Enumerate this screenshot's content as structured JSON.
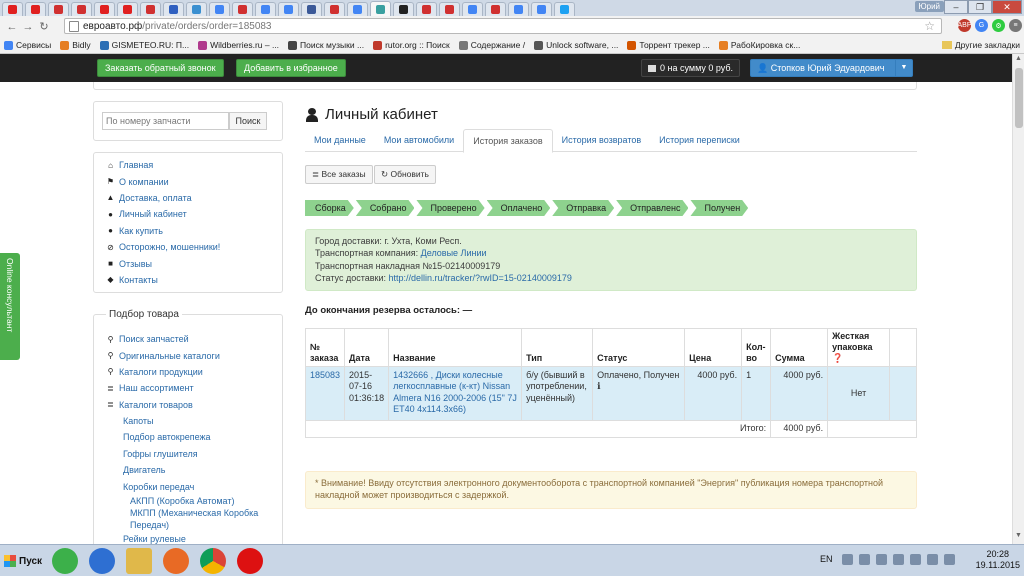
{
  "browser": {
    "tabs": [
      {
        "icon": "youtube",
        "color": "#e02020"
      },
      {
        "icon": "youtube",
        "color": "#e02020"
      },
      {
        "icon": "D",
        "color": "#d03030"
      },
      {
        "icon": "D",
        "color": "#d03030"
      },
      {
        "icon": "youtube",
        "color": "#e02020"
      },
      {
        "icon": "youtube",
        "color": "#e02020"
      },
      {
        "icon": "D",
        "color": "#d03030"
      },
      {
        "icon": "translate",
        "color": "#3060c0"
      },
      {
        "icon": "Jr",
        "color": "#3a8fd0"
      },
      {
        "icon": "G",
        "color": "#4285f4"
      },
      {
        "icon": "N",
        "color": "#d03030"
      },
      {
        "icon": "G",
        "color": "#4285f4"
      },
      {
        "icon": "G",
        "color": "#4285f4"
      },
      {
        "icon": "facebook",
        "color": "#3b5998"
      },
      {
        "icon": "D",
        "color": "#d03030"
      },
      {
        "icon": "G",
        "color": "#4285f4"
      },
      {
        "icon": "ea",
        "color": "#3aa0a0"
      },
      {
        "icon": "amazon",
        "color": "#222"
      },
      {
        "icon": "gift",
        "color": "#d03030"
      },
      {
        "icon": "gift",
        "color": "#d03030"
      },
      {
        "icon": "G",
        "color": "#4285f4"
      },
      {
        "icon": "gift",
        "color": "#d03030"
      },
      {
        "icon": "G",
        "color": "#4285f4"
      },
      {
        "icon": "G",
        "color": "#4285f4"
      },
      {
        "icon": "twitter",
        "color": "#1da1f2"
      }
    ],
    "user_badge": "Юрий",
    "url_host": "евроавто.рф",
    "url_path": "/private/orders/order=185083",
    "bookmarks": [
      "Сервисы",
      "Bidly",
      "GISMETEO.RU: П...",
      "Wildberries.ru – ...",
      "Поиск музыки ...",
      "rutor.org :: Поиск",
      "Содержание /",
      "Unlock software, ...",
      "Торрент трекер ...",
      "РабоКировка ск..."
    ],
    "other_bookmarks": "Другие закладки"
  },
  "site": {
    "callback_btn": "Заказать обратный звонок",
    "favorites_btn": "Добавить в избранное",
    "cart": "0 на сумму 0 руб.",
    "user": "Стопков Юрий Эдуардович"
  },
  "sidebar": {
    "search_placeholder": "По номеру запчасти",
    "search_btn": "Поиск",
    "menu": [
      {
        "label": "Главная",
        "icon": "home-icon",
        "glyph": "⌂"
      },
      {
        "label": "О компании",
        "icon": "flag-icon",
        "glyph": "⚑"
      },
      {
        "label": "Доставка, оплата",
        "icon": "road-icon",
        "glyph": "▲"
      },
      {
        "label": "Личный кабинет",
        "icon": "user-icon",
        "glyph": "●"
      },
      {
        "label": "Как купить",
        "icon": "cart-icon",
        "glyph": "●"
      },
      {
        "label": "Осторожно, мошенники!",
        "icon": "ban-icon",
        "glyph": "⊘"
      },
      {
        "label": "Отзывы",
        "icon": "comment-icon",
        "glyph": "■"
      },
      {
        "label": "Контакты",
        "icon": "marker-icon",
        "glyph": "◆"
      }
    ],
    "selection_title": "Подбор товара",
    "selection": [
      {
        "label": "Поиск запчастей",
        "icon": "search-icon",
        "glyph": "⚲"
      },
      {
        "label": "Оригинальные каталоги",
        "icon": "search-icon",
        "glyph": "⚲"
      },
      {
        "label": "Каталоги продукции",
        "icon": "search-icon",
        "glyph": "⚲"
      },
      {
        "label": "Наш ассортимент",
        "icon": "list-icon",
        "glyph": "≣"
      },
      {
        "label": "Каталоги товаров",
        "icon": "list-icon",
        "glyph": "≣"
      }
    ],
    "sub": [
      "Капоты",
      "Подбор автокрепежа",
      "Гофры глушителя",
      "Двигатель",
      "Коробки передач"
    ],
    "sub2": [
      "АКПП (Коробка Автомат)",
      "МКПП (Механическая Коробка Передач)"
    ],
    "sub_last": "Рейки рулевые",
    "online": "Online консультант"
  },
  "cabinet": {
    "title": "Личный кабинет",
    "tabs": [
      "Мои данные",
      "Мои автомобили",
      "История заказов",
      "История возвратов",
      "История переписки"
    ],
    "all_orders": "Все заказы",
    "refresh": "Обновить",
    "steps": [
      "Сборка",
      "Собрано",
      "Проверено",
      "Оплачено",
      "Отправка",
      "Отправленс",
      "Получен"
    ],
    "info": {
      "city": "Город доставки: г. Ухта, Коми Респ.",
      "company_label": "Транспортная компания:",
      "company": "Деловые Линии",
      "waybill": "Транспортная накладная №15-02140009179",
      "status_label": "Статус доставки:",
      "status_link": "http://dellin.ru/tracker/?rwID=15-02140009179"
    },
    "reserve": "До окончания резерва осталось: —",
    "table": {
      "headers": [
        "№ заказа",
        "Дата",
        "Название",
        "Тип",
        "Статус",
        "Цена",
        "Кол-во",
        "Сумма",
        "Жесткая упаковка ❓"
      ],
      "row": {
        "num": "185083",
        "date": "2015-07-16 01:36:18",
        "name": "1432666 , Диски колесные легкосплавные (к-кт) Nissan Almera N16 2000-2006 (15\" 7J ET40 4x114.3x66)",
        "type": "б/у (бывший в употреблении, уценённый)",
        "status": "Оплачено, Получен",
        "price": "4000 руб.",
        "qty": "1",
        "sum": "4000 руб.",
        "pack": "Нет"
      },
      "total_label": "Итого:",
      "total": "4000 руб."
    },
    "warning": "* Внимание! Ввиду отсутствия электронного документооборота с транспортной компанией \"Энергия\" публикация номера транспортной накладной может производиться с задержкой."
  },
  "taskbar": {
    "start": "Пуск",
    "lang": "EN",
    "time": "20:28",
    "date": "19.11.2015"
  }
}
